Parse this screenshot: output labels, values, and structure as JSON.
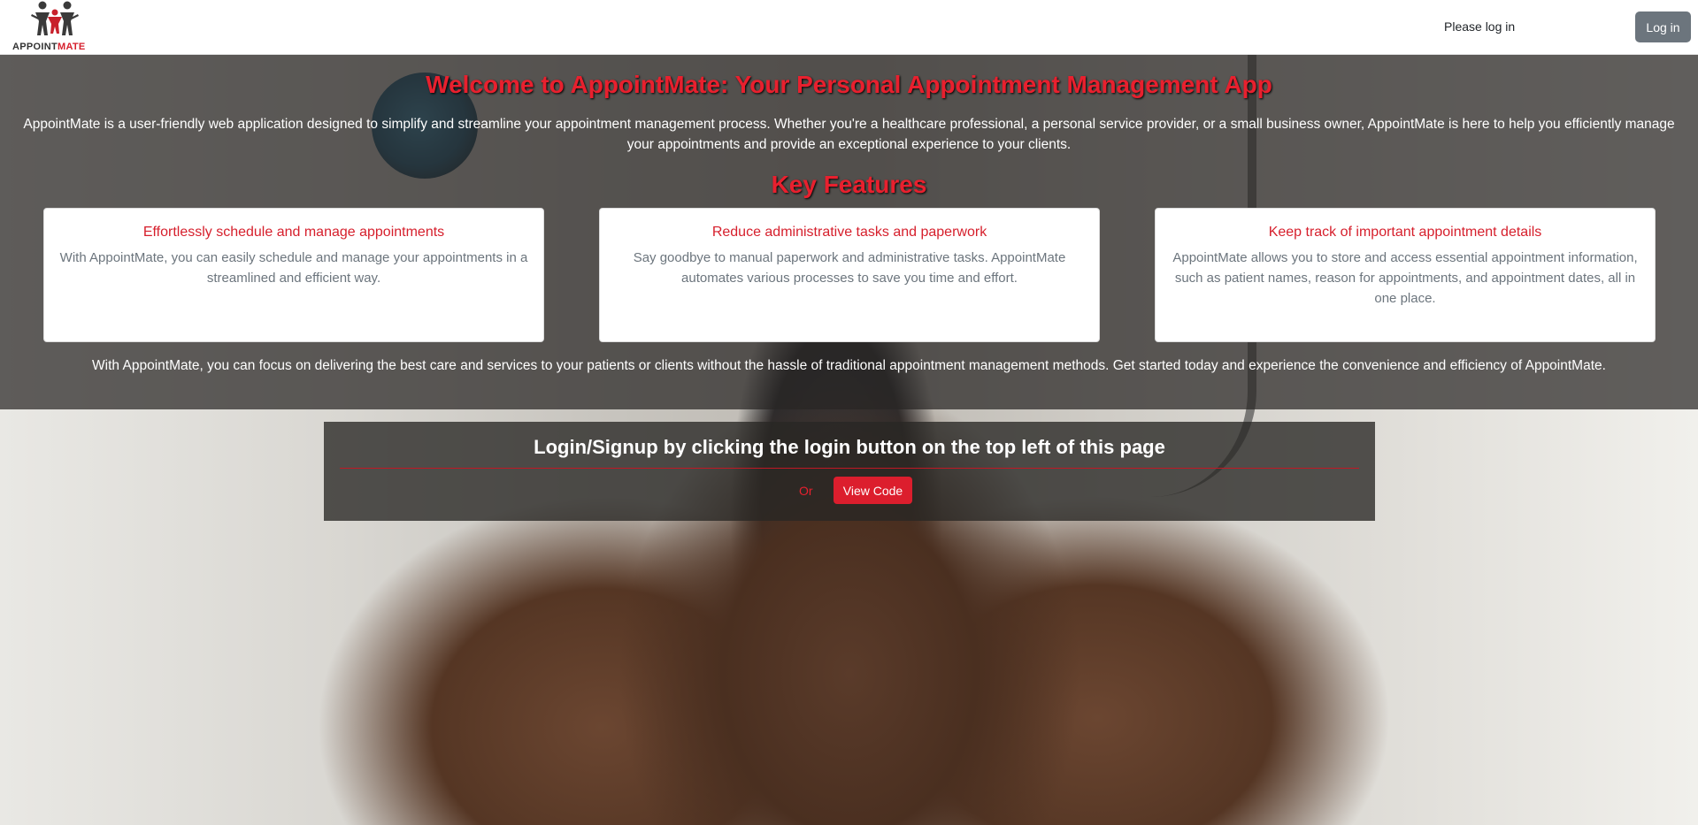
{
  "header": {
    "logo_brand_part1": "APPOINT",
    "logo_brand_part2": "MATE",
    "status_text": "Please log in",
    "login_button": "Log in"
  },
  "hero": {
    "title": "Welcome to AppointMate: Your Personal Appointment Management App",
    "description": "AppointMate is a user-friendly web application designed to simplify and streamline your appointment management process. Whether you're a healthcare professional, a personal service provider, or a small business owner, AppointMate is here to help you efficiently manage your appointments and provide an exceptional experience to your clients.",
    "features_title": "Key Features",
    "features": [
      {
        "title": "Effortlessly schedule and manage appointments",
        "text": "With AppointMate, you can easily schedule and manage your appointments in a streamlined and efficient way."
      },
      {
        "title": "Reduce administrative tasks and paperwork",
        "text": "Say goodbye to manual paperwork and administrative tasks. AppointMate automates various processes to save you time and effort."
      },
      {
        "title": "Keep track of important appointment details",
        "text": "AppointMate allows you to store and access essential appointment information, such as patient names, reason for appointments, and appointment dates, all in one place."
      }
    ],
    "footer": "With AppointMate, you can focus on delivering the best care and services to your patients or clients without the hassle of traditional appointment management methods. Get started today and experience the convenience and efficiency of AppointMate."
  },
  "login_panel": {
    "title": "Login/Signup by clicking the login button on the top left of this page",
    "or_label": "Or",
    "view_code_button": "View Code"
  },
  "colors": {
    "accent_red": "#e8202e",
    "button_gray": "#6c757d",
    "overlay": "#282624"
  }
}
